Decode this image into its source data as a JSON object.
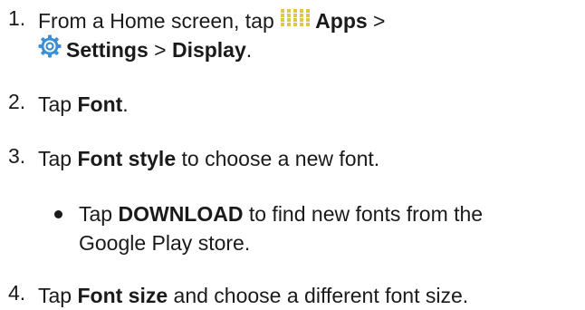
{
  "steps": [
    {
      "number": "1.",
      "line1": {
        "pre": "From a Home screen, tap ",
        "bold": "Apps",
        "post": " >"
      },
      "line2": {
        "bold1": "Settings",
        "sep": " > ",
        "bold2": "Display",
        "post": "."
      },
      "icons": [
        "apps-grid-icon",
        "settings-gear-icon"
      ]
    },
    {
      "number": "2.",
      "pre": "Tap ",
      "bold": "Font",
      "post": "."
    },
    {
      "number": "3.",
      "pre": "Tap ",
      "bold": "Font style",
      "post": " to choose a new font.",
      "bullet": {
        "pre": "Tap ",
        "bold": "DOWNLOAD",
        "post": " to find new fonts from the",
        "line2": "Google Play store."
      }
    },
    {
      "number": "4.",
      "pre": "Tap ",
      "bold": "Font size",
      "post": " and choose a different font size."
    }
  ],
  "colors": {
    "text": "#1a1a1a",
    "apps_icon": "#e2c64a",
    "settings_icon": "#3a8fd6"
  }
}
